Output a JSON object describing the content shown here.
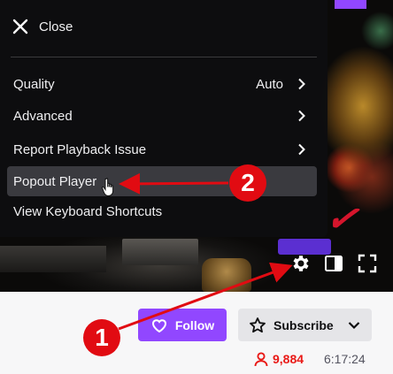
{
  "menu": {
    "close_label": "Close",
    "items": [
      {
        "label": "Quality",
        "value": "Auto"
      },
      {
        "label": "Advanced",
        "value": ""
      },
      {
        "label": "Report Playback Issue",
        "value": ""
      },
      {
        "label": "Popout Player",
        "value": ""
      },
      {
        "label": "View Keyboard Shortcuts",
        "value": ""
      }
    ]
  },
  "player_controls": {
    "icons": [
      "gear-icon",
      "theatre-mode-icon",
      "fullscreen-icon"
    ]
  },
  "channel_actions": {
    "follow_label": "Follow",
    "subscribe_label": "Subscribe"
  },
  "stream_info": {
    "viewer_count": "9,884",
    "uptime": "6:17:24"
  },
  "annotations": {
    "step_1": "1",
    "step_2": "2",
    "color": "#e10b12"
  },
  "colors": {
    "brand": "#9147ff",
    "live_red": "#e91916"
  }
}
